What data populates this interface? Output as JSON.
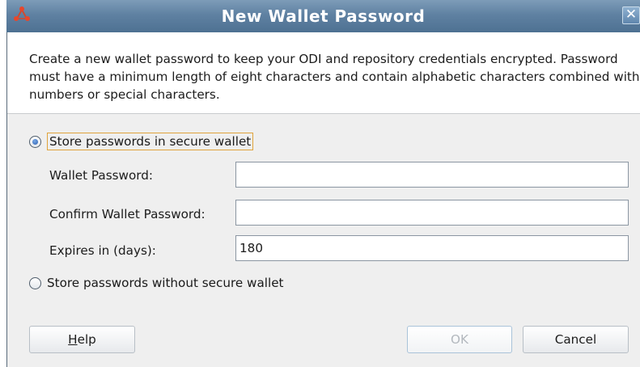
{
  "window": {
    "title": "New Wallet Password",
    "close_glyph": "✕",
    "app_icon": "oracle-app-icon"
  },
  "description": "Create a new wallet password to keep your ODI and repository credentials encrypted. Password must have a minimum length of eight characters and contain alphabetic characters combined with numbers or special characters.",
  "options": {
    "secure_wallet": {
      "label": "Store passwords in secure wallet",
      "selected": true
    },
    "no_wallet": {
      "label": "Store passwords without secure wallet",
      "selected": false
    }
  },
  "fields": {
    "wallet_password": {
      "label": "Wallet Password:",
      "value": ""
    },
    "confirm_password": {
      "label": "Confirm Wallet Password:",
      "value": ""
    },
    "expires": {
      "label": "Expires in (days):",
      "value": "180"
    }
  },
  "buttons": {
    "help": {
      "mnemonic": "H",
      "rest": "elp"
    },
    "ok": "OK",
    "cancel": "Cancel"
  },
  "colors": {
    "title_bar": "#5f81a2",
    "focus_border": "#e0a33b",
    "radio_selected": "#2a5fb0"
  }
}
